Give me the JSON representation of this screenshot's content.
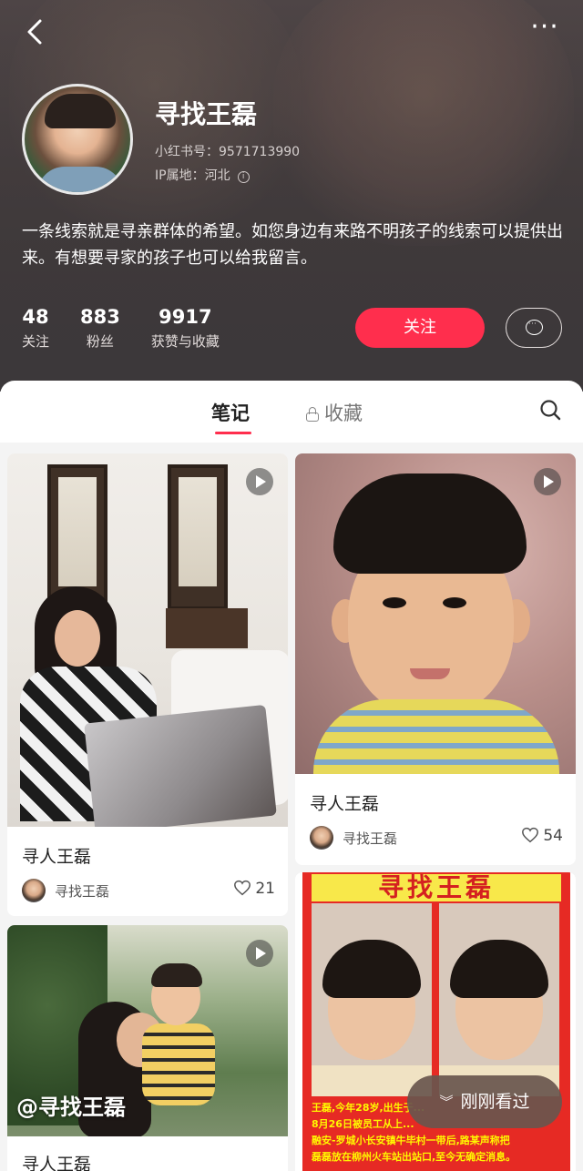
{
  "header": {
    "name": "寻找王磊",
    "id_text": "小红书号：9571713990",
    "ip_text": "IP属地：河北",
    "bio": "一条线索就是寻亲群体的希望。如您身边有来路不明孩子的线索可以提供出来。有想要寻家的孩子也可以给我留言。",
    "more_icon": "more-dots-icon",
    "back_icon": "back-chevron-icon"
  },
  "stats": [
    {
      "num": "48",
      "label": "关注"
    },
    {
      "num": "883",
      "label": "粉丝"
    },
    {
      "num": "9917",
      "label": "获赞与收藏"
    }
  ],
  "actions": {
    "follow_label": "关注",
    "message_icon": "message-bubble-icon"
  },
  "tabs": {
    "notes": "笔记",
    "collections": "收藏"
  },
  "cards": [
    {
      "title": "寻人王磊",
      "author": "寻找王磊",
      "likes": "21",
      "is_video": true
    },
    {
      "title": "寻人王磊",
      "author": "寻找王磊",
      "likes": "54",
      "is_video": true
    },
    {
      "title": "寻人王磊",
      "watermark": "@寻找王磊",
      "is_video": true
    },
    {
      "poster_banner": "寻找王磊",
      "poster_lines": [
        "王磊,今年28岁,出生于...",
        "8月26日被员工从上...",
        "融安-罗城小长安镇牛毕村一带后,路某声称把",
        "磊磊放在柳州火车站出站口,至今无确定消息。"
      ]
    }
  ],
  "recent_pill": {
    "label": "刚刚看过",
    "icon": "double-chevron-down-icon"
  },
  "colors": {
    "accent": "#ff2e4d",
    "header_bg": "#4e4646",
    "feed_bg": "#f4f4f4"
  }
}
